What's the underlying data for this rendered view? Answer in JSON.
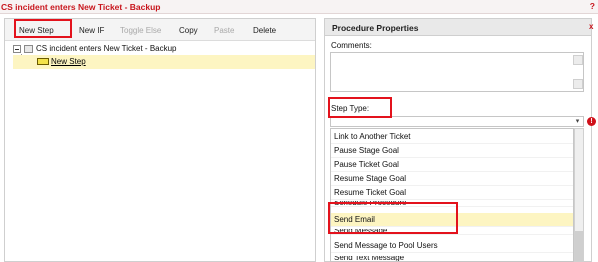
{
  "window": {
    "title": "CS incident enters New Ticket - Backup",
    "help_glyph": "?"
  },
  "toolbar": {
    "new_step": "New Step",
    "new_if": "New IF",
    "toggle_else": "Toggle Else",
    "copy": "Copy",
    "paste": "Paste",
    "delete": "Delete"
  },
  "tree": {
    "root_label": "CS incident enters New Ticket - Backup",
    "child_label": "New Step"
  },
  "properties": {
    "title": "Procedure Properties",
    "close_glyph": "x",
    "comments_label": "Comments:",
    "comments_value": "",
    "step_type_label": "Step Type:",
    "step_type_value": "",
    "error_glyph": "!"
  },
  "step_types": [
    "Link to Another Ticket",
    "Pause Stage Goal",
    "Pause Ticket Goal",
    "Resume Stage Goal",
    "Resume Ticket Goal",
    "Schedule Procedure",
    "Send Email",
    "Send Message",
    "Send Message to Pool Users",
    "Send Text Message"
  ],
  "selected_step_type": "Send Email",
  "colors": {
    "accent_red": "#e3121c",
    "title_red": "#c8161d",
    "selection": "#fdf5c2"
  }
}
